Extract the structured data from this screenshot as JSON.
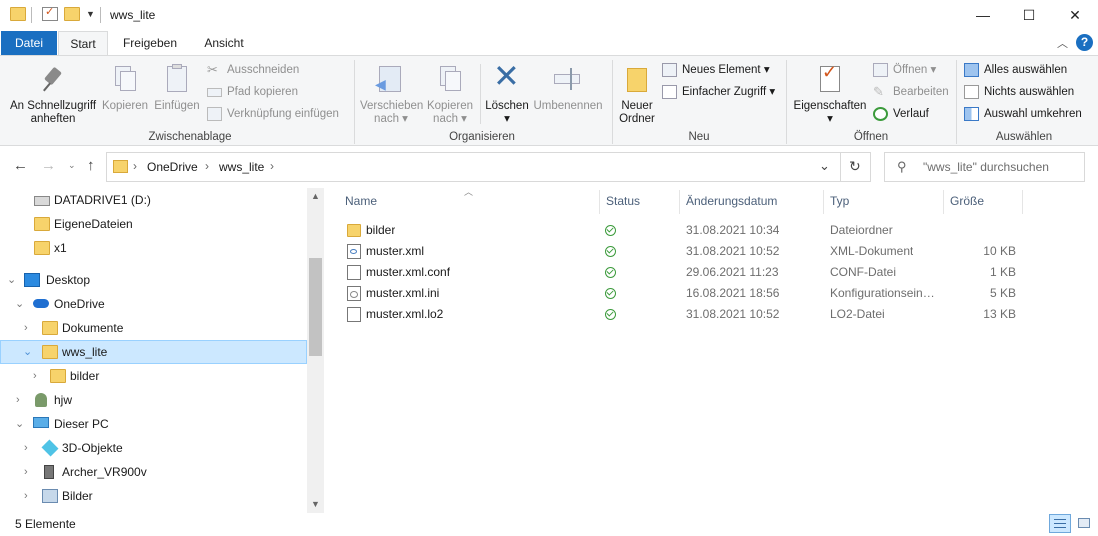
{
  "window": {
    "title": "wws_lite",
    "minimize_glyph": "—",
    "maximize_glyph": "☐",
    "close_glyph": "✕"
  },
  "ribbon_tabs": [
    {
      "label": "Datei"
    },
    {
      "label": "Start"
    },
    {
      "label": "Freigeben"
    },
    {
      "label": "Ansicht"
    }
  ],
  "ribbon": {
    "clipboard": {
      "group_label": "Zwischenablage",
      "pin_label_1": "An Schnellzugriff",
      "pin_label_2": "anheften",
      "copy_label": "Kopieren",
      "paste_label": "Einfügen",
      "cut_label": "Ausschneiden",
      "copy_path_label": "Pfad kopieren",
      "paste_shortcut_label": "Verknüpfung einfügen"
    },
    "organize": {
      "group_label": "Organisieren",
      "move_label_1": "Verschieben",
      "move_label_2": "nach ▾",
      "copyto_label_1": "Kopieren",
      "copyto_label_2": "nach ▾",
      "delete_label_1": "Löschen",
      "delete_label_2": "▾",
      "rename_label": "Umbenennen"
    },
    "new": {
      "group_label": "Neu",
      "new_folder_label_1": "Neuer",
      "new_folder_label_2": "Ordner",
      "new_item_label": "Neues Element ▾",
      "easy_access_label": "Einfacher Zugriff ▾"
    },
    "open": {
      "group_label": "Öffnen",
      "properties_label_1": "Eigenschaften",
      "properties_label_2": "▾",
      "open_label": "Öffnen ▾",
      "edit_label": "Bearbeiten",
      "history_label": "Verlauf"
    },
    "select": {
      "group_label": "Auswählen",
      "select_all_label": "Alles auswählen",
      "select_none_label": "Nichts auswählen",
      "invert_label": "Auswahl umkehren"
    }
  },
  "address": {
    "breadcrumb": [
      "OneDrive",
      "wws_lite"
    ],
    "search_placeholder": "\"wws_lite\" durchsuchen"
  },
  "nav": {
    "items": [
      {
        "label": "DATADRIVE1 (D:)",
        "icon": "drive-icon"
      },
      {
        "label": "EigeneDateien",
        "icon": "folder-icon"
      },
      {
        "label": "x1",
        "icon": "folder-icon"
      },
      {
        "label": "Desktop",
        "icon": "desktop-icon"
      },
      {
        "label": "OneDrive",
        "icon": "cloud-icon"
      },
      {
        "label": "Dokumente",
        "icon": "folder-icon"
      },
      {
        "label": "wws_lite",
        "icon": "folder-icon"
      },
      {
        "label": "bilder",
        "icon": "folder-icon"
      },
      {
        "label": "hjw",
        "icon": "user-icon"
      },
      {
        "label": "Dieser PC",
        "icon": "computer-icon"
      },
      {
        "label": "3D-Objekte",
        "icon": "cube-icon"
      },
      {
        "label": "Archer_VR900v",
        "icon": "network-device-icon"
      },
      {
        "label": "Bilder",
        "icon": "pictures-icon"
      }
    ]
  },
  "files": {
    "columns": [
      "Name",
      "Status",
      "Änderungsdatum",
      "Typ",
      "Größe"
    ],
    "rows": [
      {
        "name": "bilder",
        "date": "31.08.2021 10:34",
        "type": "Dateiordner",
        "size": ""
      },
      {
        "name": "muster.xml",
        "date": "31.08.2021 10:52",
        "type": "XML-Dokument",
        "size": "10 KB"
      },
      {
        "name": "muster.xml.conf",
        "date": "29.06.2021 11:23",
        "type": "CONF-Datei",
        "size": "1 KB"
      },
      {
        "name": "muster.xml.ini",
        "date": "16.08.2021 18:56",
        "type": "Konfigurationsein…",
        "size": "5 KB"
      },
      {
        "name": "muster.xml.lo2",
        "date": "31.08.2021 10:52",
        "type": "LO2-Datei",
        "size": "13 KB"
      }
    ]
  },
  "statusbar": {
    "count": "5 Elemente"
  },
  "colors": {
    "accent": "#1a6fc1",
    "selection": "#cce8ff",
    "folder": "#f7d36b",
    "status_ok": "#3c9b3c"
  }
}
